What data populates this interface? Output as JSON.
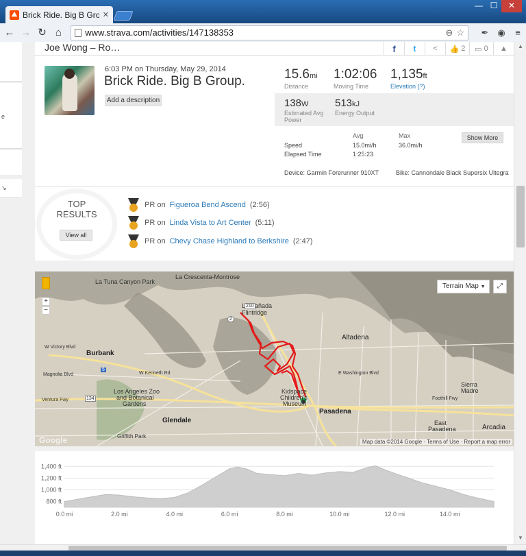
{
  "browser": {
    "tab_title": "Brick Ride. Big B Group. | S",
    "url": "www.strava.com/activities/147138353",
    "icons": [
      "strava-favicon",
      "back-arrow",
      "forward-arrow",
      "reload",
      "home",
      "zoom",
      "star",
      "extension",
      "menu"
    ]
  },
  "header": {
    "athlete_name": "Joe Wong – Ro…",
    "kudos_count": "2",
    "comment_count": "0"
  },
  "activity": {
    "date_line": "6:03 PM on Thursday, May 29, 2014",
    "title": "Brick Ride. Big B Group.",
    "add_description": "Add a description"
  },
  "stats": {
    "distance_value": "15.6",
    "distance_unit": "mi",
    "distance_label": "Distance",
    "moving_time_value": "1:02:06",
    "moving_time_label": "Moving Time",
    "elevation_value": "1,135",
    "elevation_unit": "ft",
    "elevation_label": "Elevation (?)",
    "power_value": "138",
    "power_unit": "W",
    "power_label": "Estimated Avg Power",
    "energy_value": "513",
    "energy_unit": "kJ",
    "energy_label": "Energy Output",
    "avg_header": "Avg",
    "max_header": "Max",
    "speed_label": "Speed",
    "speed_avg": "15.0mi/h",
    "speed_max": "36.0mi/h",
    "elapsed_label": "Elapsed Time",
    "elapsed_value": "1:25:23",
    "show_more": "Show More",
    "device": "Device: Garmin Forerunner 910XT",
    "bike": "Bike: Cannondale Black Supersix Ultegra"
  },
  "top_results": {
    "title": "TOP RESULTS",
    "view_all": "View all",
    "items": [
      {
        "prefix": "PR on",
        "segment": "Figueroa Bend Ascend",
        "time": "(2:56)"
      },
      {
        "prefix": "PR on",
        "segment": "Linda Vista to Art Center",
        "time": "(5:11)"
      },
      {
        "prefix": "PR on",
        "segment": "Chevy Chase Highland to Berkshire",
        "time": "(2:47)"
      }
    ]
  },
  "map": {
    "type_button": "Terrain Map",
    "attribution": "Map data ©2014 Google · Terms of Use · Report a map error",
    "labels": {
      "crescenta": "La Crescenta-Montrose",
      "canada": "La Cañada",
      "flintridge": "Flintridge",
      "altadena": "Altadena",
      "burbank": "Burbank",
      "glendale": "Glendale",
      "pasadena": "Pasadena",
      "kidspace1": "Kidspace",
      "kidspace2": "Children's",
      "kidspace3": "Museum",
      "zoo1": "Los Angeles Zoo",
      "zoo2": "and Botanical",
      "zoo3": "Gardens",
      "sierra1": "Sierra",
      "sierra2": "Madre",
      "eastpas1": "East",
      "eastpas2": "Pasadena",
      "arcadia": "Arcadia",
      "lacamada": "La Tuna Canyon Park",
      "foothill": "Foothill Fwy",
      "wvictory": "W Victory Blvd",
      "magnolia": "Magnolia Blvd",
      "kenneth": "W Kenneth Rd",
      "ventura": "Ventura Fwy",
      "washington": "E Washington Blvd",
      "griffith": "Griffith Park",
      "hwy210": "210",
      "hwy134": "134",
      "hwy2": "2",
      "hwy5": "5"
    }
  },
  "elevation": {
    "y_ticks": [
      "1,400 ft",
      "1,200 ft",
      "1,000 ft",
      "800 ft"
    ],
    "x_ticks": [
      "0.0 mi",
      "2.0 mi",
      "4.0 mi",
      "6.0 mi",
      "8.0 mi",
      "10.0 mi",
      "12.0 mi",
      "14.0 mi"
    ]
  },
  "chart_data": {
    "type": "area",
    "title": "",
    "xlabel": "",
    "ylabel": "",
    "x_unit": "mi",
    "y_unit": "ft",
    "xlim": [
      0,
      15.6
    ],
    "ylim": [
      700,
      1450
    ],
    "x": [
      0,
      0.5,
      1,
      1.5,
      2,
      2.5,
      3,
      3.5,
      4,
      4.5,
      5,
      5.5,
      6,
      6.3,
      6.6,
      7,
      7.5,
      8,
      8.5,
      9,
      9.5,
      10,
      10.5,
      11,
      11.3,
      11.6,
      12,
      12.5,
      13,
      13.5,
      14,
      14.5,
      15,
      15.6
    ],
    "series": [
      {
        "values": [
          800,
          840,
          880,
          920,
          910,
          880,
          860,
          850,
          870,
          950,
          1080,
          1220,
          1360,
          1390,
          1360,
          1280,
          1260,
          1240,
          1280,
          1250,
          1290,
          1310,
          1300,
          1380,
          1410,
          1350,
          1280,
          1200,
          1120,
          1060,
          1000,
          920,
          860,
          800
        ]
      }
    ],
    "grid": true,
    "fill_color": "#cfcfcf"
  }
}
